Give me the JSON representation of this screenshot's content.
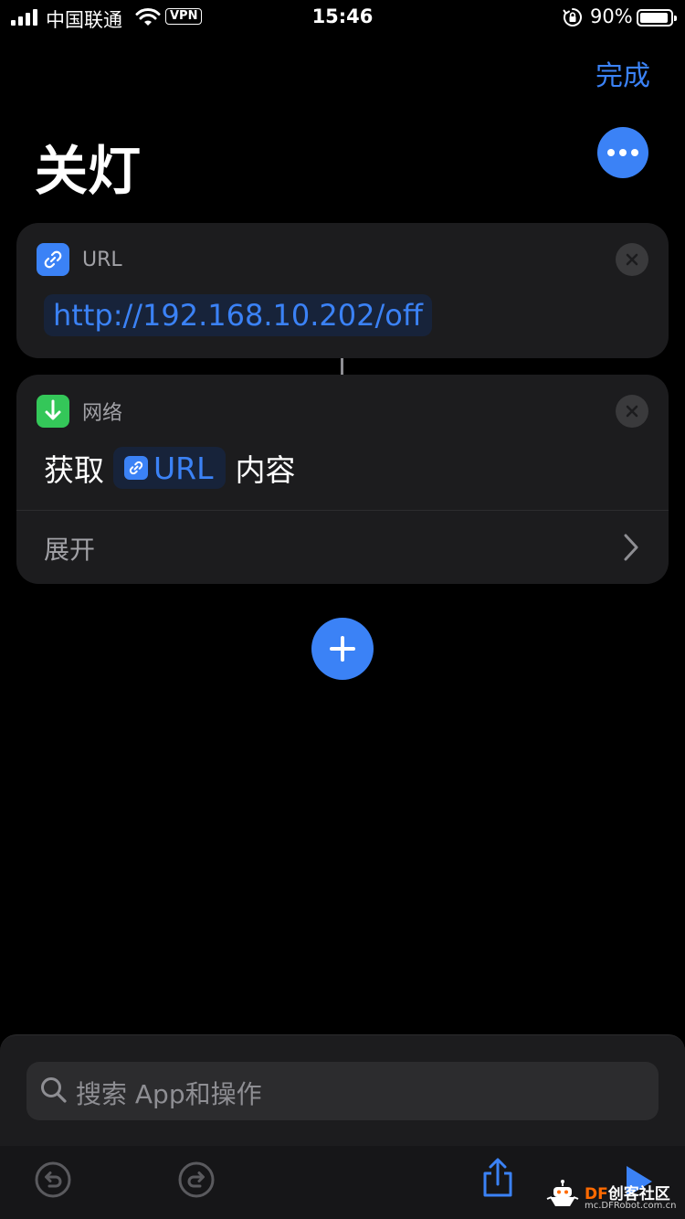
{
  "status_bar": {
    "carrier": "中国联通",
    "vpn": "VPN",
    "time": "15:46",
    "battery_percent": "90%"
  },
  "nav": {
    "done_label": "完成",
    "title": "关灯"
  },
  "actions": [
    {
      "app_label": "URL",
      "app_icon": "link-icon",
      "value": "http://192.168.10.202/off"
    },
    {
      "app_label": "网络",
      "app_icon": "download-arrow-icon",
      "prefix": "获取",
      "variable": "URL",
      "suffix": "内容",
      "expand_label": "展开"
    }
  ],
  "search": {
    "placeholder": "搜索 App和操作"
  },
  "watermark": {
    "brand_prefix": "DF",
    "brand_suffix": "创客社区",
    "url": "mc.DFRobot.com.cn"
  },
  "colors": {
    "accent": "#3b82f6",
    "card": "#1c1c1e",
    "network_green": "#34c759"
  }
}
